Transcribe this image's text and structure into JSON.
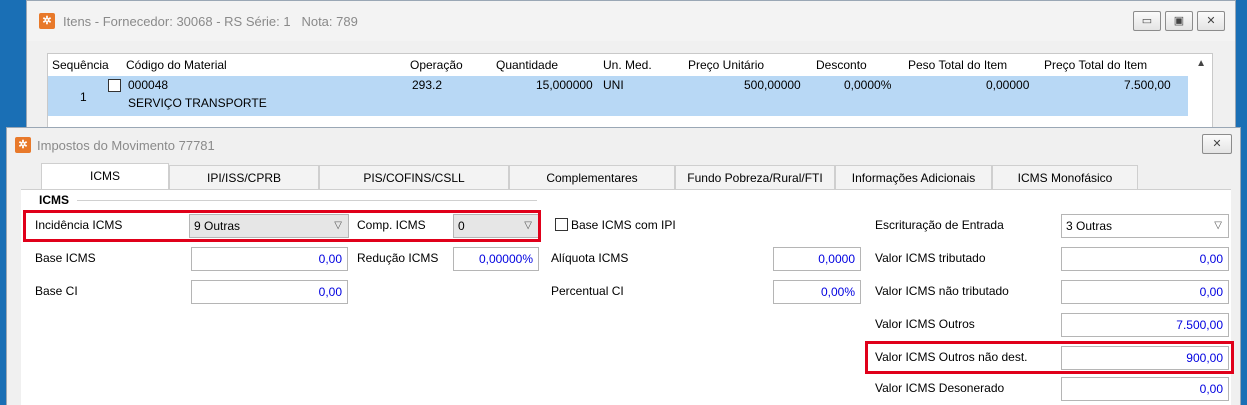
{
  "itens_window": {
    "title": "Itens - Fornecedor: 30068 - RS Série: 1   Nota: 789",
    "columns": [
      "Sequência",
      "Código do Material",
      "Operação",
      "Quantidade",
      "Un. Med.",
      "Preço Unitário",
      "Desconto",
      "Peso Total do Item",
      "Preço Total do Item"
    ],
    "row": {
      "sequencia": "1",
      "codigo": "000048",
      "descricao": "SERVIÇO TRANSPORTE",
      "operacao": "293.2",
      "quantidade": "15,000000",
      "un_med": "UNI",
      "preco_unitario": "500,00000",
      "desconto": "0,0000%",
      "peso_total": "0,00000",
      "preco_total": "7.500,00"
    }
  },
  "impostos_window": {
    "title": "Impostos do Movimento 77781",
    "tabs": [
      "ICMS",
      "IPI/ISS/CPRB",
      "PIS/COFINS/CSLL",
      "Complementares",
      "Fundo Pobreza/Rural/FTI",
      "Informações Adicionais",
      "ICMS Monofásico"
    ],
    "group_title": "ICMS",
    "fields": {
      "incidencia_label": "Incidência ICMS",
      "incidencia_value": "9 Outras",
      "comp_label": "Comp. ICMS",
      "comp_value": "0",
      "base_icms_ipi_label": "Base ICMS com IPI",
      "escrituracao_label": "Escrituração de Entrada",
      "escrituracao_value": "3 Outras",
      "base_icms_label": "Base ICMS",
      "base_icms_value": "0,00",
      "reducao_label": "Redução ICMS",
      "reducao_value": "0,00000%",
      "aliquota_label": "Alíquota ICMS",
      "aliquota_value": "0,0000",
      "vl_tributado_label": "Valor ICMS tributado",
      "vl_tributado_value": "0,00",
      "base_ci_label": "Base CI",
      "base_ci_value": "0,00",
      "percentual_ci_label": "Percentual CI",
      "percentual_ci_value": "0,00%",
      "vl_nao_tributado_label": "Valor ICMS não tributado",
      "vl_nao_tributado_value": "0,00",
      "vl_outros_label": "Valor ICMS Outros",
      "vl_outros_value": "7.500,00",
      "vl_outros_nao_dest_label": "Valor ICMS Outros não dest.",
      "vl_outros_nao_dest_value": "900,00",
      "vl_desonerado_label": "Valor ICMS Desonerado",
      "vl_desonerado_value": "0,00"
    }
  },
  "glyphs": {
    "app_icon": "✲",
    "minimize": "▭",
    "maximize": "▣",
    "close": "✕",
    "dropdown": "▽",
    "scroll_up": "▲"
  },
  "colors": {
    "highlight": "#e0001a",
    "selected_row": "#b8d8f5",
    "value_text": "#0000e0",
    "app_icon": "#e8792a"
  }
}
